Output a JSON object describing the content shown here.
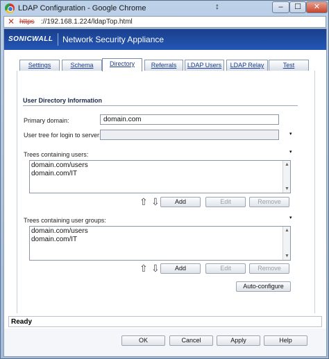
{
  "window": {
    "title": "LDAP Configuration - Google Chrome",
    "url_protocol": "https",
    "url_rest": "://192.168.1.224/ldapTop.html",
    "min_glyph": "–",
    "max_glyph": "☐",
    "close_glyph": "✕"
  },
  "banner": {
    "logo": "SONICWALL",
    "product": "Network Security Appliance"
  },
  "tabs": [
    {
      "label": "Settings"
    },
    {
      "label": "Schema"
    },
    {
      "label": "Directory"
    },
    {
      "label": "Referrals"
    },
    {
      "label": "LDAP Users"
    },
    {
      "label": "LDAP Relay"
    },
    {
      "label": "Test"
    }
  ],
  "active_tab": "Directory",
  "section": {
    "title": "User Directory Information"
  },
  "fields": {
    "primary_domain_label": "Primary domain:",
    "primary_domain_value": "domain.com",
    "user_tree_label": "User tree for login to server:",
    "user_tree_value": ""
  },
  "trees_users": {
    "label": "Trees containing users:",
    "items": [
      "domain.com/users",
      "domain.com/IT"
    ]
  },
  "trees_groups": {
    "label": "Trees containing user groups:",
    "items": [
      "domain.com/users",
      "domain.com/IT"
    ]
  },
  "list_buttons": {
    "add": "Add",
    "edit": "Edit",
    "remove": "Remove"
  },
  "auto_configure": "Auto-configure",
  "status": "Ready",
  "footer": {
    "ok": "OK",
    "cancel": "Cancel",
    "apply": "Apply",
    "help": "Help"
  },
  "icons": {
    "up_arrow": "⇧",
    "down_arrow": "⇩",
    "scroll_up": "▲",
    "scroll_down": "▼",
    "cert_error": "✕",
    "tick": "▾",
    "titlebar_arrow": "↕"
  },
  "colors": {
    "banner": "#2456b5",
    "tab_link": "#1b3d8a",
    "cert_error": "#c0392b"
  }
}
